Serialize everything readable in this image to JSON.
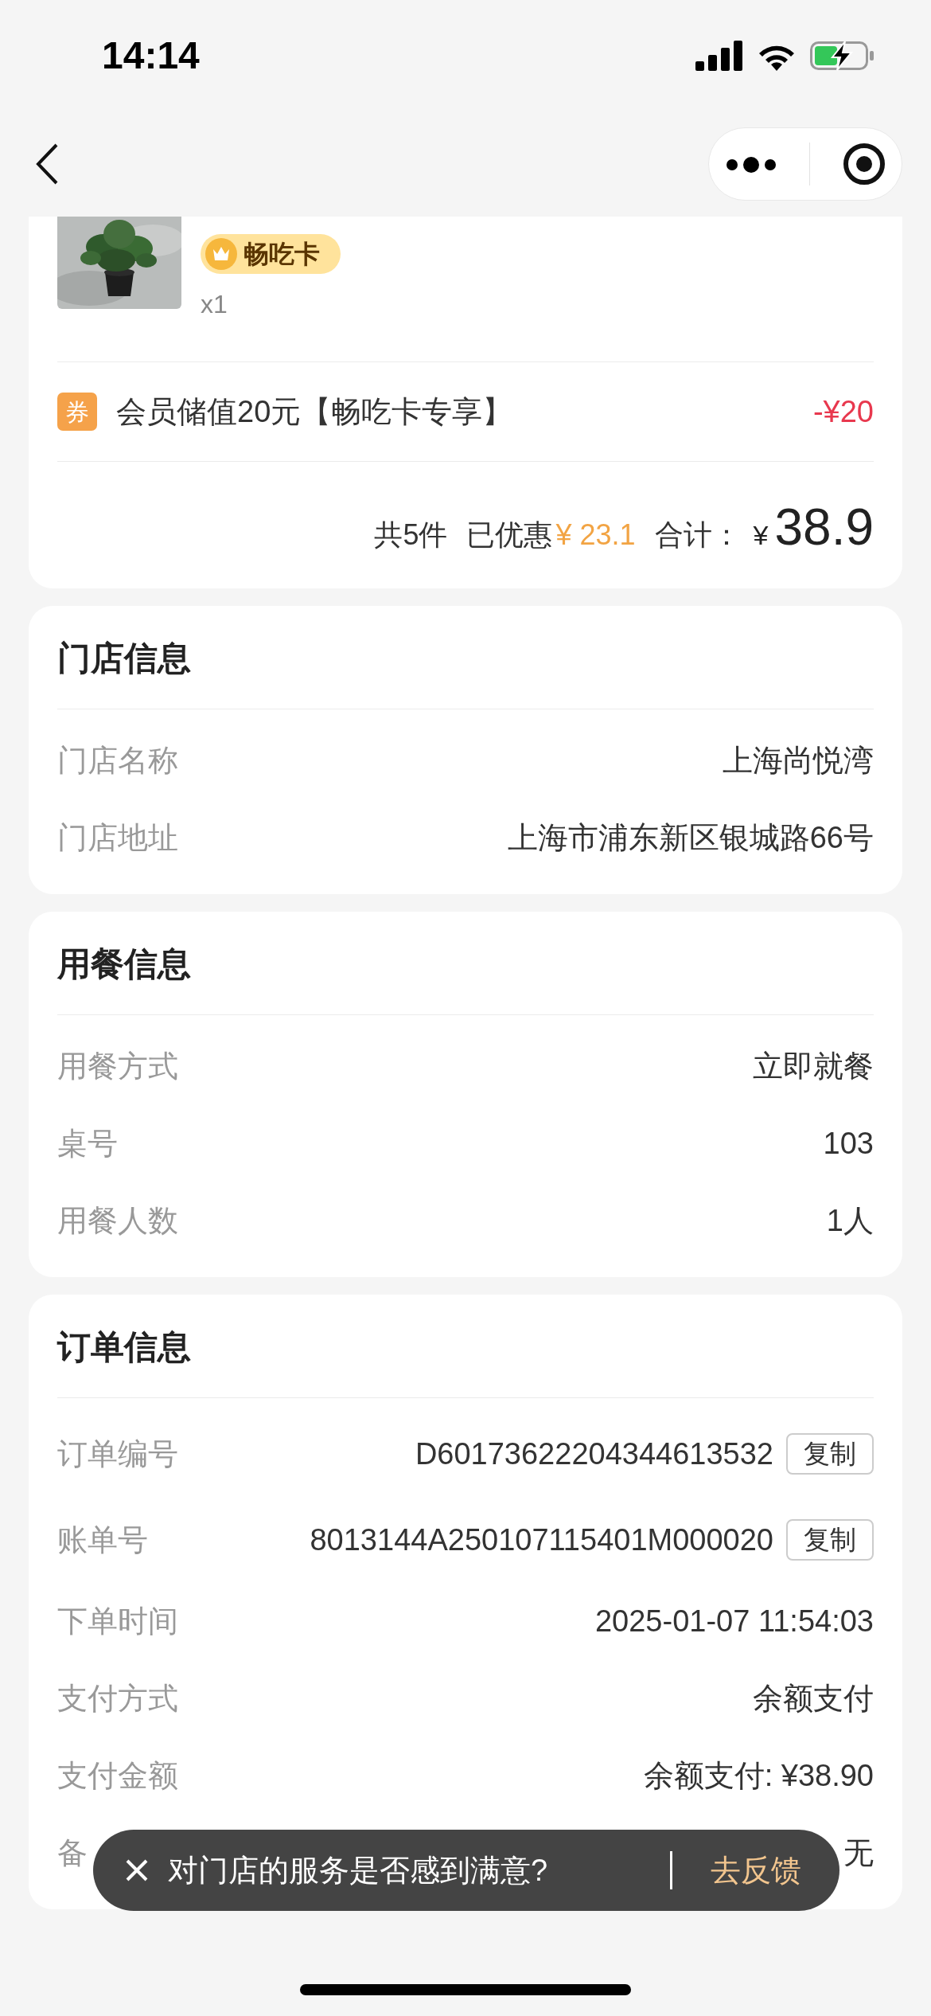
{
  "status_bar": {
    "time": "14:14"
  },
  "product": {
    "kind": "picture",
    "badge": "畅吃卡",
    "quantity": "x1"
  },
  "discount": {
    "icon_text": "券",
    "label": "会员储值20元【畅吃卡专享】",
    "amount": "-¥20"
  },
  "summary": {
    "count": "共5件",
    "discount_label": "已优惠",
    "discount_value": "¥ 23.1",
    "total_label": "合计：",
    "currency": "¥",
    "total": "38.9"
  },
  "sections": [
    {
      "title": "门店信息",
      "rows": [
        {
          "label": "门店名称",
          "value": "上海尚悦湾"
        },
        {
          "label": "门店地址",
          "value": "上海市浦东新区银城路66号"
        }
      ]
    },
    {
      "title": "用餐信息",
      "rows": [
        {
          "label": "用餐方式",
          "value": "立即就餐"
        },
        {
          "label": "桌号",
          "value": "103"
        },
        {
          "label": "用餐人数",
          "value": "1人"
        }
      ]
    },
    {
      "title": "订单信息",
      "rows": [
        {
          "label": "订单编号",
          "value": "D60173622204344613532",
          "copy": "复制"
        },
        {
          "label": "账单号",
          "value": "8013144A250107115401M000020",
          "copy": "复制"
        },
        {
          "label": "下单时间",
          "value": "2025-01-07 11:54:03"
        },
        {
          "label": "支付方式",
          "value": "余额支付"
        },
        {
          "label": "支付金额",
          "value": "余额支付: ¥38.90"
        },
        {
          "label": "备",
          "value": "无"
        }
      ]
    }
  ],
  "toast": {
    "message": "对门店的服务是否感到满意?",
    "action": "去反馈"
  }
}
